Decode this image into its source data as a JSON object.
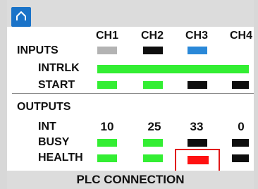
{
  "header": {
    "home_icon": "home-icon"
  },
  "columns": [
    "CH1",
    "CH2",
    "CH3",
    "CH4"
  ],
  "inputs": {
    "section_label": "INPUTS",
    "channel_leds": [
      "gray",
      "black",
      "blue",
      "black"
    ],
    "intrlk": {
      "label": "INTRLK",
      "state": "green"
    },
    "start": {
      "label": "START",
      "leds": [
        "green",
        "green",
        "black",
        "black"
      ]
    }
  },
  "outputs": {
    "section_label": "OUTPUTS",
    "int": {
      "label": "INT",
      "values": [
        "10",
        "25",
        "33",
        "0"
      ]
    },
    "busy": {
      "label": "BUSY",
      "leds": [
        "green",
        "green",
        "black",
        "black"
      ]
    },
    "health": {
      "label": "HEALTH",
      "leds": [
        "green",
        "green",
        "red",
        "black"
      ]
    }
  },
  "footer": {
    "label": "PLC CONNECTION"
  },
  "colors": {
    "green": "#33ee33",
    "black": "#0e0e0e",
    "gray": "#b3b3b3",
    "blue": "#2a88d8",
    "red": "#ff1111",
    "accent": "#1a73c8",
    "highlight": "#e11a1a"
  }
}
